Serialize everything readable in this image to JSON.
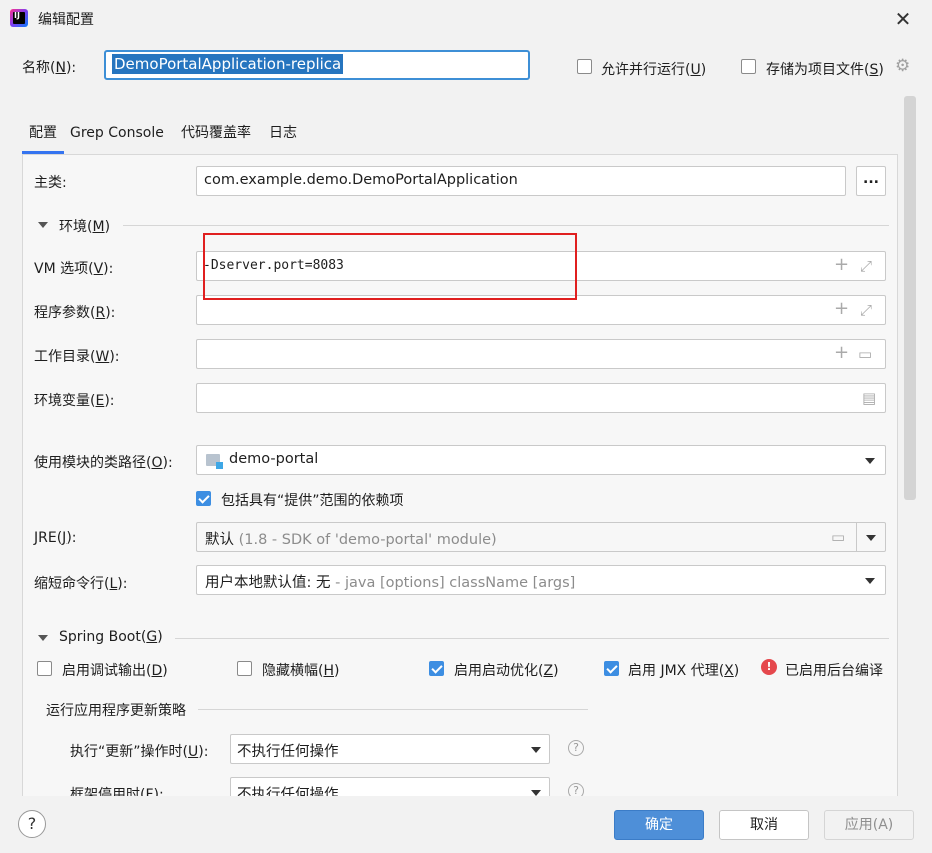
{
  "window": {
    "title": "编辑配置",
    "logo_text": "IJ"
  },
  "name_row": {
    "label": "名称",
    "mnemonic": "N",
    "value": "DemoPortalApplication-replica",
    "parallel": {
      "label": "允许并行运行",
      "mnemonic": "U",
      "checked": false
    },
    "store": {
      "label": "存储为项目文件",
      "mnemonic": "S",
      "checked": false
    }
  },
  "tabs": [
    {
      "label": "配置",
      "active": true
    },
    {
      "label": "Grep Console",
      "active": false
    },
    {
      "label": "代码覆盖率",
      "active": false
    },
    {
      "label": "日志",
      "active": false
    }
  ],
  "main_class": {
    "label": "主类:",
    "value": "com.example.demo.DemoPortalApplication",
    "browse": "..."
  },
  "environment": {
    "title": "环境",
    "mnemonic": "M",
    "vm_options": {
      "label": "VM 选项",
      "mnemonic": "V",
      "value": "-Dserver.port=8083"
    },
    "program_args": {
      "label": "程序参数",
      "mnemonic": "R",
      "value": ""
    },
    "working_dir": {
      "label": "工作目录",
      "mnemonic": "W",
      "value": ""
    },
    "env_vars": {
      "label": "环境变量",
      "mnemonic": "E",
      "value": ""
    }
  },
  "module_classpath": {
    "label": "使用模块的类路径",
    "mnemonic": "O",
    "value": "demo-portal"
  },
  "include_provided": {
    "label": "包括具有“提供”范围的依赖项",
    "checked": true
  },
  "jre": {
    "label": "JRE",
    "mnemonic": "J",
    "value": "默认",
    "hint": "(1.8 - SDK of 'demo-portal' module)"
  },
  "shorten_cmd": {
    "label": "缩短命令行",
    "mnemonic": "L",
    "value": "用户本地默认值: 无",
    "hint": "- java [options] className [args]"
  },
  "spring_boot": {
    "title": "Spring Boot",
    "mnemonic": "G",
    "options": [
      {
        "label": "启用调试输出",
        "mnemonic": "D",
        "checked": false
      },
      {
        "label": "隐藏横幅",
        "mnemonic": "H",
        "checked": false
      },
      {
        "label": "启用启动优化",
        "mnemonic": "Z",
        "checked": true
      },
      {
        "label": "启用 JMX 代理",
        "mnemonic": "X",
        "checked": true
      }
    ],
    "background_compile": "已启用后台编译",
    "update_policy_title": "运行应用程序更新策略",
    "on_update": {
      "label": "执行“更新”操作时",
      "mnemonic": "U",
      "value": "不执行任何操作"
    },
    "on_frame_deactivate": {
      "label": "框架停用时",
      "mnemonic": "F",
      "value": "不执行任何操作"
    }
  },
  "buttons": {
    "help": "?",
    "ok": "确定",
    "cancel": "取消",
    "apply": "应用(A)"
  },
  "colors": {
    "accent": "#3574f0",
    "primary_button": "#4e8fd8",
    "highlight": "#e01f1f"
  }
}
